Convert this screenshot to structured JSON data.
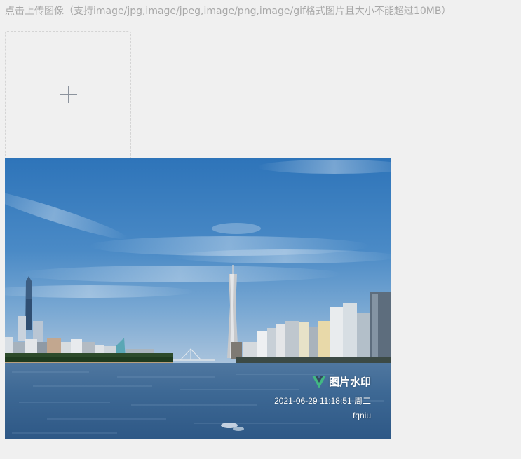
{
  "upload": {
    "hint": "点击上传图像（支持image/jpg,image/jpeg,image/png,image/gif格式图片且大小不能超过10MB）",
    "add_icon": "plus-icon"
  },
  "preview": {
    "watermark": {
      "logo_icon": "vue-logo-icon",
      "title": "图片水印",
      "timestamp": "2021-06-29 11:18:51 周二",
      "user": "fqniu"
    }
  },
  "colors": {
    "page_bg": "#f0f0f0",
    "hint_text": "#a8a8a8",
    "plus": "#8c939d",
    "vue_green": "#42b883",
    "vue_dark": "#35495e"
  }
}
